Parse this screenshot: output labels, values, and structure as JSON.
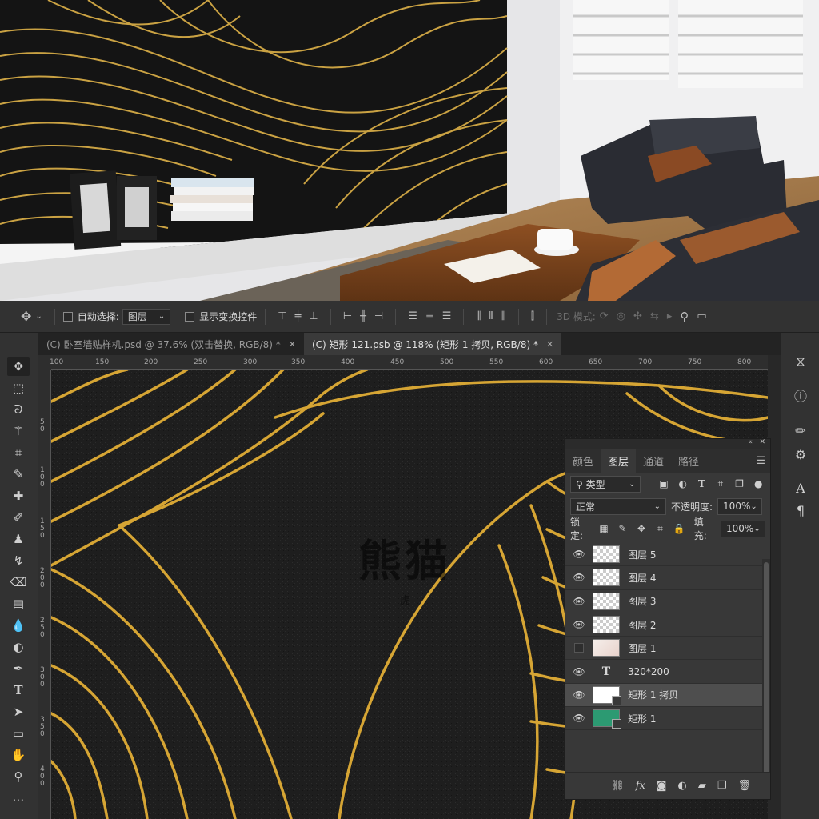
{
  "options_bar": {
    "move_icon": "move-icon",
    "auto_select_label": "自动选择:",
    "auto_select_value": "图层",
    "show_transform_label": "显示变换控件",
    "mode_3d_label": "3D 模式:"
  },
  "tabs": [
    {
      "label": "(C) 卧室墙贴样机.psd @ 37.6% (双击替换, RGB/8) *",
      "active": false
    },
    {
      "label": "(C) 矩形 121.psb @ 118% (矩形 1 拷贝, RGB/8) *",
      "active": true
    }
  ],
  "ruler": {
    "h_ticks": [
      "100",
      "150",
      "200",
      "250",
      "300",
      "350",
      "400",
      "450",
      "500",
      "550",
      "600",
      "650",
      "700",
      "750",
      "800"
    ],
    "v_ticks": [
      "5 0",
      "1 0 0",
      "1 5 0",
      "2 0 0",
      "2 5 0",
      "3 0 0",
      "3 5 0",
      "4 0 0"
    ]
  },
  "canvas": {
    "watermark": "熊猫",
    "sub_mark": "虎"
  },
  "layers_panel": {
    "tabs": [
      "颜色",
      "图层",
      "通道",
      "路径"
    ],
    "active_tab": "图层",
    "filter_label": "类型",
    "blend_mode": "正常",
    "opacity_label": "不透明度:",
    "opacity_value": "100%",
    "lock_label": "锁定:",
    "fill_label": "填充:",
    "fill_value": "100%",
    "layers": [
      {
        "name": "图层 5",
        "visible": true,
        "thumb": "transparent"
      },
      {
        "name": "图层 4",
        "visible": true,
        "thumb": "transparent"
      },
      {
        "name": "图层 3",
        "visible": true,
        "thumb": "transparent"
      },
      {
        "name": "图层 2",
        "visible": true,
        "thumb": "transparent"
      },
      {
        "name": "图层 1",
        "visible": false,
        "thumb": "image"
      },
      {
        "name": "320*200",
        "visible": true,
        "thumb": "text"
      },
      {
        "name": "矩形 1 拷贝",
        "visible": true,
        "thumb": "white-shape",
        "selected": true
      },
      {
        "name": "矩形 1",
        "visible": true,
        "thumb": "green-shape"
      }
    ]
  },
  "colors": {
    "gold": "#d8a630",
    "canvas_bg": "#1d1d1d",
    "accent_green": "#2c9a72"
  }
}
